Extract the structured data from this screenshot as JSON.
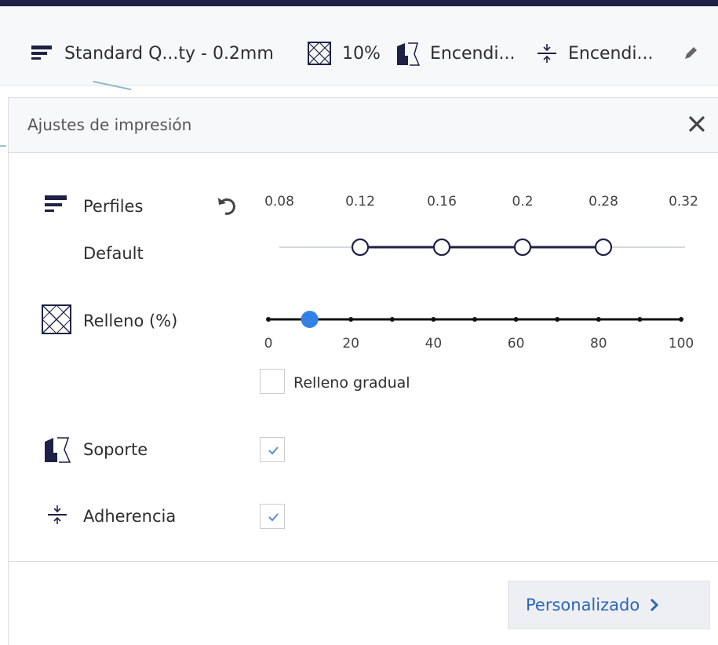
{
  "topbar": {
    "profile_label": "Standard Q...ty - 0.2mm",
    "infill_label": "10%",
    "support_label": "Encendi...",
    "adhesion_label": "Encendi..."
  },
  "panel": {
    "title": "Ajustes de impresión"
  },
  "profiles": {
    "label": "Perfiles",
    "sublabel": "Default",
    "layer_heights": [
      "0.08",
      "0.12",
      "0.16",
      "0.2",
      "0.28",
      "0.32"
    ],
    "available": [
      "0.12",
      "0.16",
      "0.2",
      "0.28"
    ],
    "selected": "0.2"
  },
  "infill": {
    "label": "Relleno (%)",
    "tick_labels": [
      "0",
      "20",
      "40",
      "60",
      "80",
      "100"
    ],
    "value_percent": 10,
    "gradual_label": "Relleno gradual",
    "gradual_checked": false
  },
  "support": {
    "label": "Soporte",
    "checked": true
  },
  "adhesion": {
    "label": "Adherencia",
    "checked": true
  },
  "footer": {
    "custom_button_label": "Personalizado"
  },
  "colors": {
    "accent_blue": "#2a66b8",
    "slider_handle_blue": "#3282e6",
    "profile_track_navy": "#1e2145",
    "check_blue": "#5a8ed6"
  }
}
